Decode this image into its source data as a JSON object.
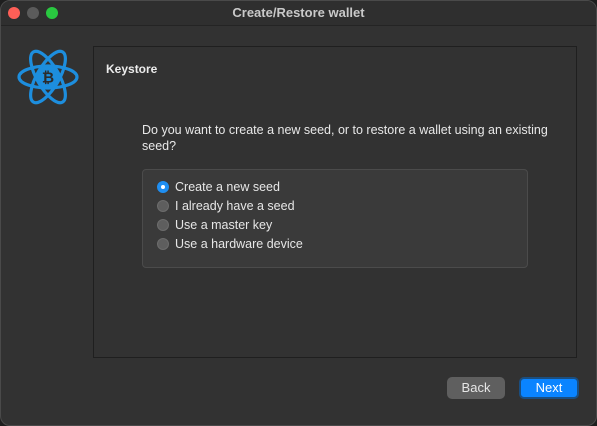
{
  "window": {
    "title": "Create/Restore wallet"
  },
  "logo": {
    "icon": "electrum-bitcoin-atom-logo",
    "glyph": "₿",
    "color": "#1d8ede"
  },
  "panel": {
    "title": "Keystore",
    "question": "Do you want to create a new seed, or to restore a wallet using an existing seed?",
    "options": [
      {
        "label": "Create a new seed",
        "selected": true
      },
      {
        "label": "I already have a seed",
        "selected": false
      },
      {
        "label": "Use a master key",
        "selected": false
      },
      {
        "label": "Use a hardware device",
        "selected": false
      }
    ]
  },
  "buttons": {
    "back": "Back",
    "next": "Next"
  },
  "colors": {
    "accent": "#0a84ff",
    "radio_selected": "#1f8ef1"
  }
}
